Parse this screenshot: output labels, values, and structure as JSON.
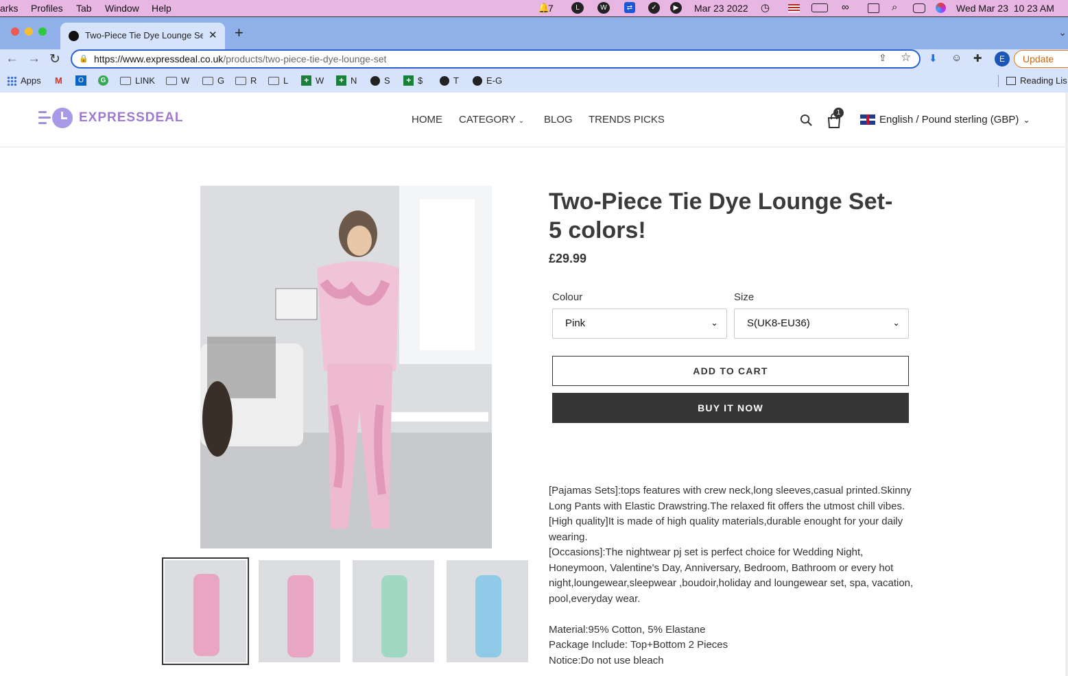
{
  "mac_menubar": {
    "items": [
      "arks",
      "Profiles",
      "Tab",
      "Window",
      "Help"
    ],
    "notification_count": "7",
    "date": "Mar 23 2022",
    "clock": "Wed Mar 23  10 23 AM"
  },
  "browser": {
    "tab_title": "Two-Piece Tie Dye Lounge Set",
    "url_host": "https://www.expressdeal.co.uk",
    "url_path": "/products/two-piece-tie-dye-lounge-set",
    "update_label": "Update",
    "avatar_letter": "E",
    "bookmarks": [
      "Apps",
      "LINK",
      "W",
      "G",
      "R",
      "L",
      "W",
      "N",
      "S",
      "$",
      "T",
      "E-G"
    ],
    "reading_list": "Reading Lis"
  },
  "store": {
    "logo_text": "EXPRESSDEAL",
    "nav": [
      "HOME",
      "CATEGORY",
      "BLOG",
      "TRENDS PICKS"
    ],
    "cart_count": "1",
    "locale": "English / Pound sterling (GBP)"
  },
  "product": {
    "title_line1": "Two-Piece Tie Dye Lounge Set-",
    "title_line2": "5 colors!",
    "price": "£29.99",
    "colour_label": "Colour",
    "colour_value": "Pink",
    "size_label": "Size",
    "size_value": "S(UK8-EU36)",
    "add_to_cart": "ADD TO CART",
    "buy_now": "BUY IT NOW",
    "description": [
      "[Pajamas Sets]:tops features with crew neck,long sleeves,casual printed.Skinny Long Pants with Elastic Drawstring.The relaxed fit offers the utmost chill vibes.",
      "[High quality]It is made of high quality materials,durable enought for your daily wearing.",
      "[Occasions]:The nightwear pj set is perfect choice for Wedding Night, Honeymoon, Valentine's Day, Anniversary, Bedroom, Bathroom or every hot night,loungewear,sleepwear ,boudoir,holiday and loungewear set, spa, vacation, pool,everyday wear.",
      "",
      "Material:95% Cotton, 5% Elastane",
      "Package Include: Top+Bottom 2 Pieces",
      "Notice:Do not use bleach"
    ],
    "thumb_colors": [
      "#e8a6c3",
      "#e8a6c3",
      "#9fd9c4",
      "#8fcbe6"
    ]
  }
}
